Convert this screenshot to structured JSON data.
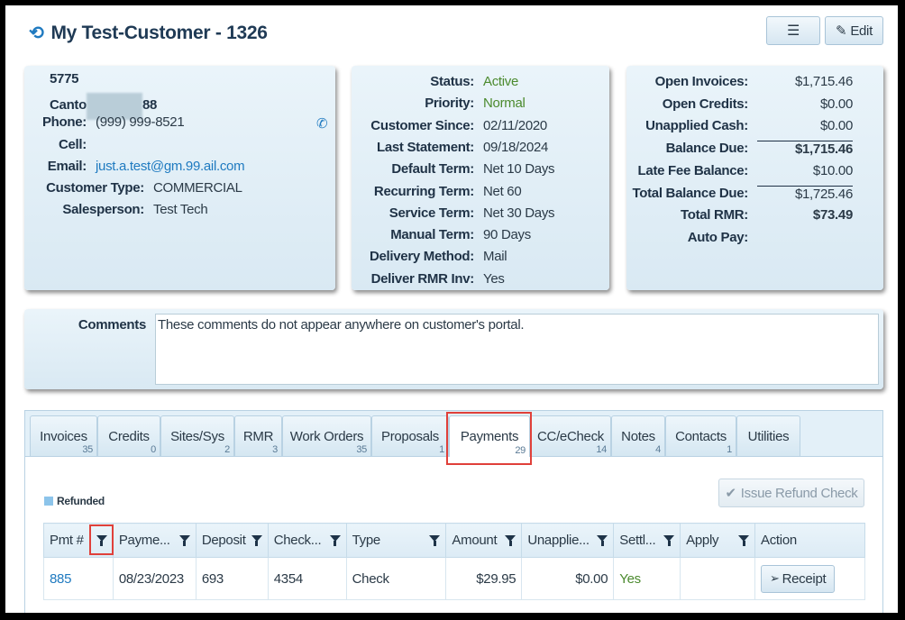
{
  "header": {
    "title": "My Test-Customer - 1326",
    "menu_icon": "list-icon",
    "edit_label": "Edit"
  },
  "contact": {
    "address1": "5775",
    "address2": "Canto",
    "address2_end": "88",
    "phone_label": "Phone:",
    "phone": "(999) 999-8521",
    "cell_label": "Cell:",
    "cell": "",
    "email_label": "Email:",
    "email": "just.a.test@gm.99.ail.com",
    "type_label": "Customer Type:",
    "type": "COMMERCIAL",
    "sales_label": "Salesperson:",
    "sales": "Test Tech"
  },
  "status": [
    {
      "label": "Status:",
      "value": "Active",
      "color": "#4b8a2e"
    },
    {
      "label": "Priority:",
      "value": "Normal",
      "color": "#4b8a2e"
    },
    {
      "label": "Customer Since:",
      "value": "02/11/2020"
    },
    {
      "label": "Last Statement:",
      "value": "09/18/2024"
    },
    {
      "label": "Default Term:",
      "value": "Net 10 Days"
    },
    {
      "label": "Recurring Term:",
      "value": "Net 60"
    },
    {
      "label": "Service Term:",
      "value": "Net 30 Days"
    },
    {
      "label": "Manual Term:",
      "value": "90 Days"
    },
    {
      "label": "Delivery Method:",
      "value": "Mail"
    },
    {
      "label": "Deliver RMR Inv:",
      "value": "Yes"
    }
  ],
  "balances": [
    {
      "label": "Open Invoices:",
      "value": "$1,715.46"
    },
    {
      "label": "Open Credits:",
      "value": "$0.00"
    },
    {
      "label": "Unapplied Cash:",
      "value": "$0.00"
    },
    {
      "label": "Balance Due:",
      "value": "$1,715.46"
    },
    {
      "label": "Late Fee Balance:",
      "value": "$10.00"
    },
    {
      "label": "Total Balance Due:",
      "value": "$1,725.46"
    },
    {
      "label": "Total RMR:",
      "value": "$73.49"
    },
    {
      "label": "Auto Pay:",
      "value": ""
    }
  ],
  "comments": {
    "label": "Comments",
    "value": "These comments do not appear anywhere on customer's portal."
  },
  "tabs": [
    {
      "label": "Invoices",
      "count": "35"
    },
    {
      "label": "Credits",
      "count": "0"
    },
    {
      "label": "Sites/Sys",
      "count": "2"
    },
    {
      "label": "RMR",
      "count": "3"
    },
    {
      "label": "Work Orders",
      "count": "35"
    },
    {
      "label": "Proposals",
      "count": "1"
    },
    {
      "label": "Payments",
      "count": "29"
    },
    {
      "label": "CC/eCheck",
      "count": "14"
    },
    {
      "label": "Notes",
      "count": "4"
    },
    {
      "label": "Contacts",
      "count": "1"
    },
    {
      "label": "Utilities",
      "count": ""
    }
  ],
  "active_tab": "Payments",
  "payments": {
    "legend": "Refunded",
    "legend_color": "#8cc4ea",
    "issue_refund_label": "Issue Refund Check",
    "columns": [
      "Pmt #",
      "Payme...",
      "Deposit",
      "Check...",
      "Type",
      "Amount",
      "Unapplie...",
      "Settl...",
      "Apply",
      "Action"
    ],
    "rows": [
      {
        "pmt": "885",
        "date": "08/23/2023",
        "deposit": "693",
        "check": "4354",
        "type": "Check",
        "amount": "$29.95",
        "unapplied": "$0.00",
        "settled": "Yes",
        "apply": "",
        "action": "Receipt"
      }
    ]
  }
}
